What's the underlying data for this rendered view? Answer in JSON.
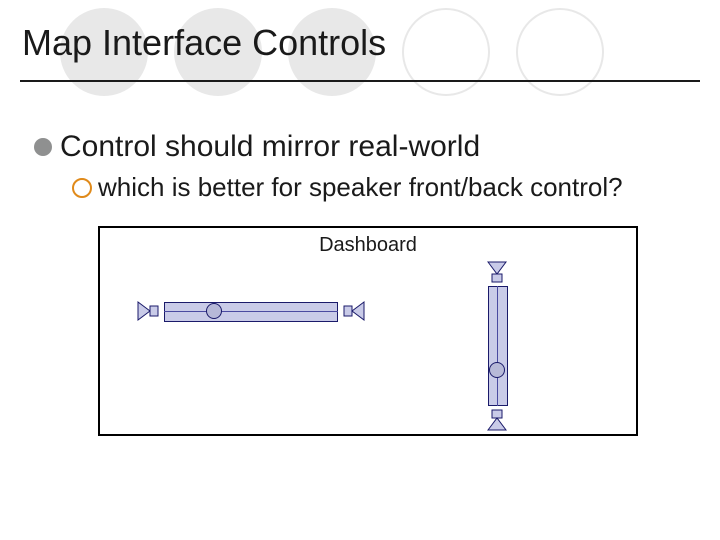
{
  "title": "Map Interface Controls",
  "bullets": {
    "b1": "Control should mirror real-world",
    "b2": "which is better for speaker front/back control?"
  },
  "panel": {
    "label": "Dashboard"
  },
  "colors": {
    "slider_fill": "#c9cbe8",
    "slider_stroke": "#1a1a6a",
    "bullet_gray": "#8f9090",
    "bullet_orange": "#e08a1a"
  }
}
